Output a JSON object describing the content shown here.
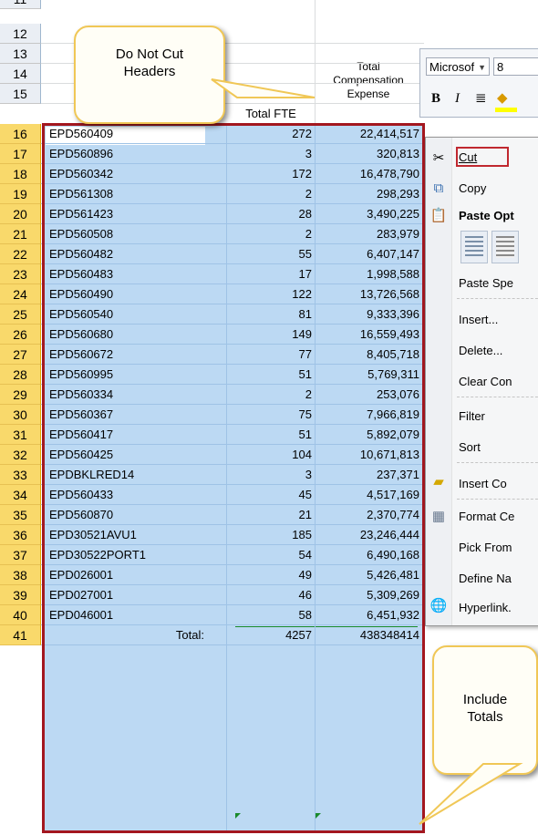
{
  "top_partial_row": "11",
  "header_rows": [
    "12",
    "13",
    "14",
    "15"
  ],
  "headers": {
    "fte": "Total FTE",
    "comp_line1": "Total",
    "comp_line2": "Compensation",
    "comp_line3": "Expense"
  },
  "rows": [
    {
      "n": "16",
      "id": "EPD560409",
      "fte": "272",
      "comp": "22,414,517"
    },
    {
      "n": "17",
      "id": "EPD560896",
      "fte": "3",
      "comp": "320,813"
    },
    {
      "n": "18",
      "id": "EPD560342",
      "fte": "172",
      "comp": "16,478,790"
    },
    {
      "n": "19",
      "id": "EPD561308",
      "fte": "2",
      "comp": "298,293"
    },
    {
      "n": "20",
      "id": "EPD561423",
      "fte": "28",
      "comp": "3,490,225"
    },
    {
      "n": "21",
      "id": "EPD560508",
      "fte": "2",
      "comp": "283,979"
    },
    {
      "n": "22",
      "id": "EPD560482",
      "fte": "55",
      "comp": "6,407,147"
    },
    {
      "n": "23",
      "id": "EPD560483",
      "fte": "17",
      "comp": "1,998,588"
    },
    {
      "n": "24",
      "id": "EPD560490",
      "fte": "122",
      "comp": "13,726,568"
    },
    {
      "n": "25",
      "id": "EPD560540",
      "fte": "81",
      "comp": "9,333,396"
    },
    {
      "n": "26",
      "id": "EPD560680",
      "fte": "149",
      "comp": "16,559,493"
    },
    {
      "n": "27",
      "id": "EPD560672",
      "fte": "77",
      "comp": "8,405,718"
    },
    {
      "n": "28",
      "id": "EPD560995",
      "fte": "51",
      "comp": "5,769,311"
    },
    {
      "n": "29",
      "id": "EPD560334",
      "fte": "2",
      "comp": "253,076"
    },
    {
      "n": "30",
      "id": "EPD560367",
      "fte": "75",
      "comp": "7,966,819"
    },
    {
      "n": "31",
      "id": "EPD560417",
      "fte": "51",
      "comp": "5,892,079"
    },
    {
      "n": "32",
      "id": "EPD560425",
      "fte": "104",
      "comp": "10,671,813"
    },
    {
      "n": "33",
      "id": "EPDBKLRED14",
      "fte": "3",
      "comp": "237,371"
    },
    {
      "n": "34",
      "id": "EPD560433",
      "fte": "45",
      "comp": "4,517,169"
    },
    {
      "n": "35",
      "id": "EPD560870",
      "fte": "21",
      "comp": "2,370,774"
    },
    {
      "n": "36",
      "id": "EPD30521AVU1",
      "fte": "185",
      "comp": "23,246,444"
    },
    {
      "n": "37",
      "id": "EPD30522PORT1",
      "fte": "54",
      "comp": "6,490,168"
    },
    {
      "n": "38",
      "id": "EPD026001",
      "fte": "49",
      "comp": "5,426,481"
    },
    {
      "n": "39",
      "id": "EPD027001",
      "fte": "46",
      "comp": "5,309,269"
    },
    {
      "n": "40",
      "id": "EPD046001",
      "fte": "58",
      "comp": "6,451,932"
    }
  ],
  "total_row": {
    "n": "41",
    "label": "Total:",
    "fte": "4257",
    "comp": "438348414"
  },
  "callouts": {
    "headers_line1": "Do Not Cut",
    "headers_line2": "Headers",
    "totals_line1": "Include",
    "totals_line2": "Totals"
  },
  "mini_toolbar": {
    "font": "Microsof",
    "size": "8",
    "bold": "B",
    "italic": "I"
  },
  "context_menu": {
    "cut": "Cut",
    "copy": "Copy",
    "paste_options": "Paste Opt",
    "paste_special": "Paste Spe",
    "insert": "Insert...",
    "delete": "Delete...",
    "clear": "Clear Con",
    "filter": "Filter",
    "sort": "Sort",
    "insert_comment": "Insert Co",
    "format_cells": "Format Ce",
    "pick_from": "Pick From",
    "define_name": "Define Na",
    "hyperlink": "Hyperlink."
  },
  "colors": {
    "selection": "#bcd9f3",
    "selection_border": "#a3171f",
    "row_header_selected": "#f9d96b",
    "callout_border": "#f0c756"
  }
}
